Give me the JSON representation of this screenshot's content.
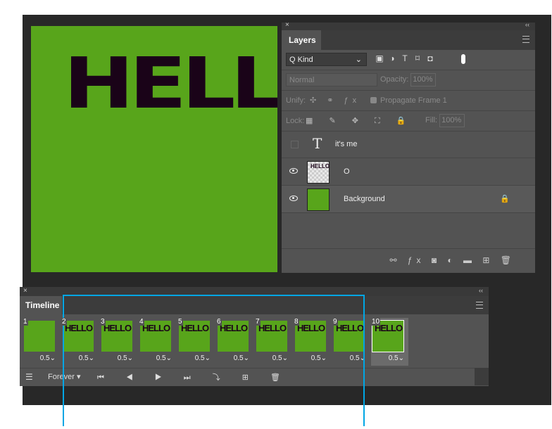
{
  "canvas": {
    "text": "HELLO",
    "background": "#58a51b",
    "text_color": "#1a0318"
  },
  "layers_panel": {
    "close": "×",
    "collapse": "‹‹",
    "tab": "Layers",
    "kind_label": "Q Kind",
    "kind_chevron": "⌄",
    "blend_mode": "Normal",
    "opacity_label": "Opacity:",
    "opacity_value": "100%",
    "unify_label": "Unify:",
    "propagate_label": "Propagate Frame 1",
    "lock_label": "Lock:",
    "fill_label": "Fill:",
    "fill_value": "100%",
    "layers": [
      {
        "name": "it's me",
        "type": "text",
        "visible": false
      },
      {
        "name": "O",
        "type": "image",
        "visible": true
      },
      {
        "name": "Background",
        "type": "background",
        "visible": true,
        "locked": true
      }
    ]
  },
  "timeline": {
    "close": "×",
    "collapse": "‹‹",
    "tab": "Timeline",
    "loop": "Forever",
    "frames": [
      {
        "n": "1",
        "dur": "0.5⌄"
      },
      {
        "n": "2",
        "dur": "0.5⌄"
      },
      {
        "n": "3",
        "dur": "0.5⌄"
      },
      {
        "n": "4",
        "dur": "0.5⌄"
      },
      {
        "n": "5",
        "dur": "0.5⌄"
      },
      {
        "n": "6",
        "dur": "0.5⌄"
      },
      {
        "n": "7",
        "dur": "0.5⌄"
      },
      {
        "n": "8",
        "dur": "0.5⌄"
      },
      {
        "n": "9",
        "dur": "0.5⌄"
      },
      {
        "n": "10",
        "dur": "0.5⌄"
      }
    ],
    "frame_labels": [
      "",
      "HELLO",
      "HELLO",
      "HELLO",
      "HELLO",
      "HELLO",
      "HELLO",
      "HELLO",
      "HELLO",
      "HELLO"
    ]
  },
  "colors": {
    "callout": "#00a6e4"
  }
}
